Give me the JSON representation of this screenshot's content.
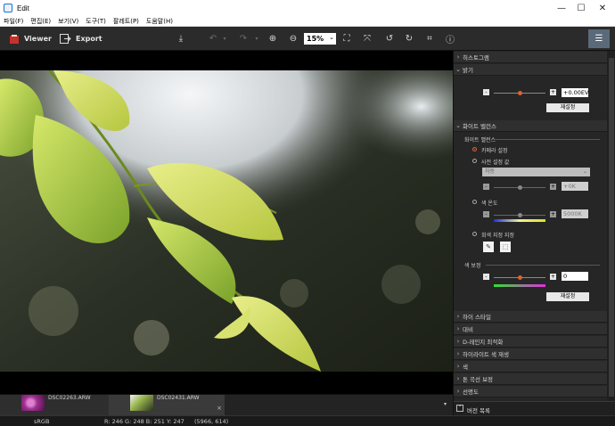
{
  "window": {
    "title": "Edit",
    "minimize": "—",
    "maximize": "☐",
    "close": "✕"
  },
  "menu": [
    {
      "label": "파일(F)"
    },
    {
      "label": "편집(E)"
    },
    {
      "label": "보기(V)"
    },
    {
      "label": "도구(T)"
    },
    {
      "label": "팔레트(P)"
    },
    {
      "label": "도움말(H)"
    }
  ],
  "toolbar": {
    "viewer_label": "Viewer",
    "export_label": "Export",
    "zoom_value": "15%"
  },
  "filmstrip": {
    "items": [
      {
        "name": "DSC02263.ARW",
        "close": "×"
      },
      {
        "name": "DSC02431.ARW",
        "close": "×"
      }
    ]
  },
  "status": {
    "color_space": "sRGB",
    "pixel_info": "R: 246  G: 248  B: 251  Y: 247",
    "coords": "(5966,  614)"
  },
  "panel": {
    "sections_top": [
      {
        "label": "히스토그램",
        "expanded": false
      },
      {
        "label": "밝기",
        "expanded": true
      }
    ],
    "brightness": {
      "value": "+0.00EV",
      "reset": "재설정",
      "minus": "-",
      "plus": "+"
    },
    "wb_section": "화이트 밸런스",
    "wb_group": "화이트 밸런스",
    "wb_options": [
      {
        "label": "카메라 설정",
        "selected": true
      },
      {
        "label": "사전 설정 값",
        "selected": false
      },
      {
        "label": "색 온도",
        "selected": false
      },
      {
        "label": "회색 지정 지정",
        "selected": false
      }
    ],
    "preset_dropdown": "자동",
    "preset_value": "+0K",
    "temp_value": "5000K",
    "tint_group": "색 보정",
    "tint_value": "0",
    "tint_reset": "재설정",
    "sections_bottom": [
      {
        "label": "하이 스타일"
      },
      {
        "label": "대비"
      },
      {
        "label": "D-레인지 최적화"
      },
      {
        "label": "하이라이트 색 재생"
      },
      {
        "label": "색"
      },
      {
        "label": "톤 곡선 보정"
      },
      {
        "label": "선명도"
      }
    ],
    "version_label": "버전 목록"
  }
}
